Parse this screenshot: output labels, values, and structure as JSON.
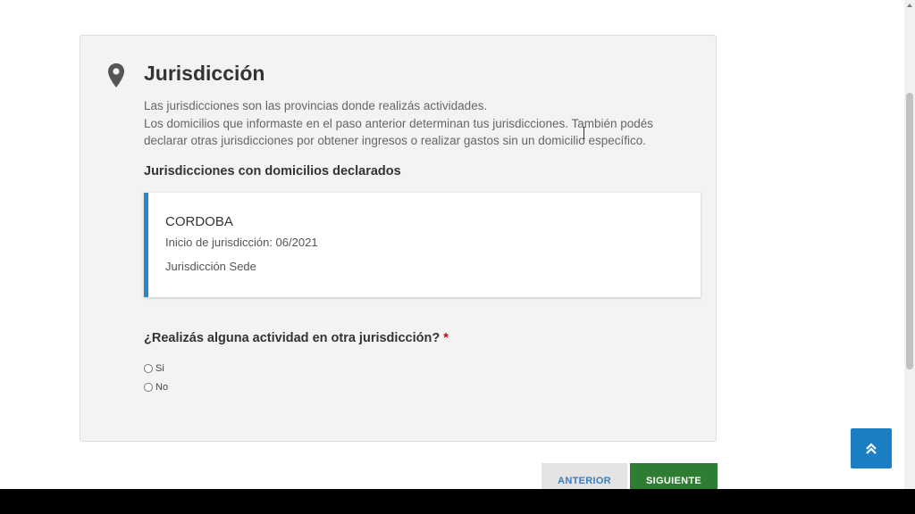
{
  "section": {
    "title": "Jurisdicción",
    "description_lines": [
      "Las jurisdicciones son las provincias donde realizás actividades.",
      "Los domicilios que informaste en el paso anterior determinan tus jurisdicciones. También podés",
      "declarar otras jurisdicciones por obtener ingresos o realizar gastos sin un domicilio específico."
    ],
    "subtitle": "Jurisdicciones con domicilios declarados"
  },
  "jurisdiction_card": {
    "name": "CORDOBA",
    "start": "Inicio de jurisdicción: 06/2021",
    "type": "Jurisdicción Sede"
  },
  "question": {
    "text": "¿Realizás alguna actividad en otra jurisdicción?",
    "required_mark": "*",
    "options": [
      "Si",
      "No"
    ]
  },
  "buttons": {
    "previous": "ANTERIOR",
    "next": "SIGUIENTE"
  },
  "colors": {
    "accent_blue": "#2a86c4",
    "next_green": "#2e7d32",
    "required_red": "#d0021b"
  }
}
